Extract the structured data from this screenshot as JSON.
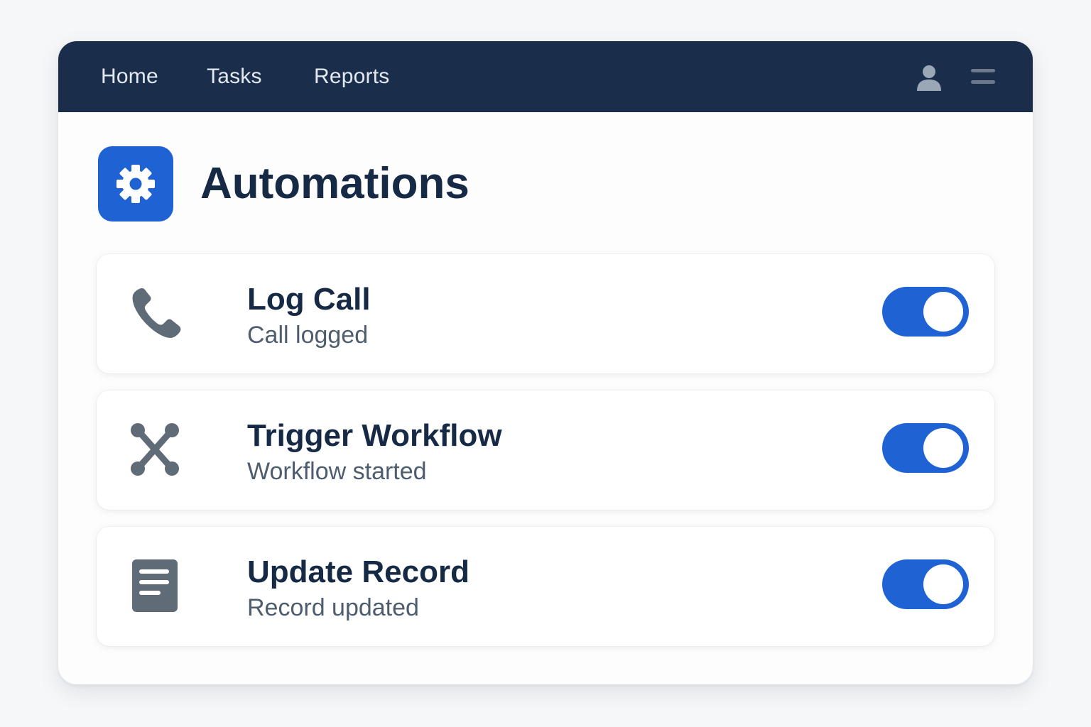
{
  "nav": {
    "items": [
      {
        "label": "Home"
      },
      {
        "label": "Tasks"
      },
      {
        "label": "Reports"
      }
    ],
    "icons": [
      "user-icon",
      "menu-icon"
    ]
  },
  "header": {
    "icon": "gear-icon",
    "title": "Automations"
  },
  "automations": [
    {
      "icon": "phone-icon",
      "title": "Log Call",
      "subtitle": "Call logged",
      "enabled": true
    },
    {
      "icon": "workflow-icon",
      "title": "Trigger Workflow",
      "subtitle": "Workflow started",
      "enabled": true
    },
    {
      "icon": "document-icon",
      "title": "Update Record",
      "subtitle": "Record updated",
      "enabled": true
    }
  ],
  "colors": {
    "navbar": "#1a2d4a",
    "accent": "#1f62d4",
    "title_text": "#172a45",
    "subtitle_text": "#4e5d6e",
    "icon_gray": "#5f6b77"
  }
}
